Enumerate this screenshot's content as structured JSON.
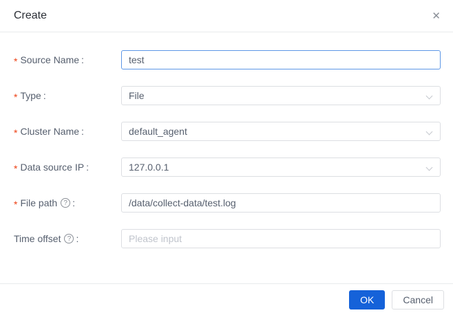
{
  "dialog": {
    "title": "Create"
  },
  "icons": {
    "close": "✕",
    "help": "?",
    "chevron_down": "v-shape-css"
  },
  "form": {
    "required_marker": "*",
    "colon": ":",
    "fields": [
      {
        "label": "Source Name",
        "required": true,
        "control": "text-input",
        "value": "test",
        "state": "focused"
      },
      {
        "label": "Type",
        "required": true,
        "control": "select",
        "value": "File"
      },
      {
        "label": "Cluster Name",
        "required": true,
        "control": "select",
        "value": "default_agent"
      },
      {
        "label": "Data source IP",
        "required": true,
        "control": "select",
        "value": "127.0.0.1"
      },
      {
        "label": "File path",
        "required": true,
        "has_help_icon": true,
        "control": "text-input",
        "value": "/data/collect-data/test.log"
      },
      {
        "label": "Time offset",
        "required": false,
        "has_help_icon": true,
        "control": "text-input",
        "value": "",
        "placeholder": "Please input"
      }
    ]
  },
  "footer": {
    "ok_label": "OK",
    "cancel_label": "Cancel"
  },
  "colors": {
    "primary": "#1562d9",
    "focus_border": "#5c96e6",
    "input_border": "#dcdee2",
    "divider": "#e8eaec",
    "required_marker": "#ed4014",
    "label_text": "#565f6e",
    "placeholder_text": "#c0c4cc"
  }
}
